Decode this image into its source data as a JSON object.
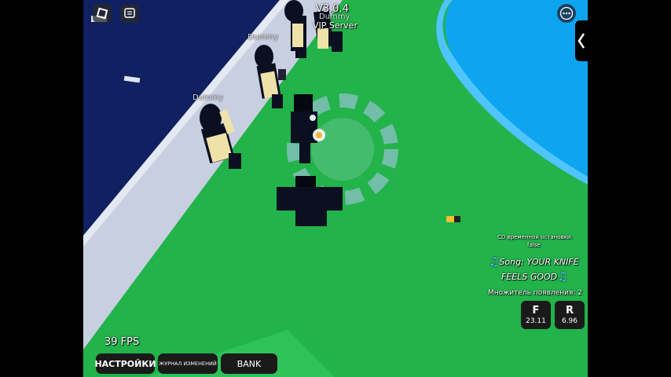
{
  "header": {
    "version": "V3.0.4",
    "server": "VIP Server"
  },
  "npcs": [
    {
      "name": "Dummy"
    },
    {
      "name": "Dummy"
    },
    {
      "name": "Dummy"
    }
  ],
  "hud": {
    "fps": "39 FPS",
    "cd_label": "CD временной остановки:",
    "cd_value": "false",
    "song": "Song: YOUR KNIFE FEELS GOOD",
    "song_line1": "Song: YOUR KNIFE",
    "song_line2": "FEELS GOOD",
    "multiplier": "Множитель появления: 2"
  },
  "skills": [
    {
      "key": "F",
      "time": "23.11"
    },
    {
      "key": "R",
      "time": "6.96"
    }
  ],
  "bottom_bar": {
    "settings": "НАСТРОЙКИ",
    "changelog": "ЖУРНАЛ ИЗМЕНЕНИЙ",
    "bank": "BANK"
  },
  "icons": [
    "roblox-menu-icon",
    "chat-icon",
    "more-options-icon",
    "side-panel-arrow-icon",
    "music-note-icon"
  ],
  "colors": {
    "grass": "#22b34a",
    "water": "#0ea5f0",
    "road": "#102060",
    "sidewalk": "#c8cfe0"
  }
}
